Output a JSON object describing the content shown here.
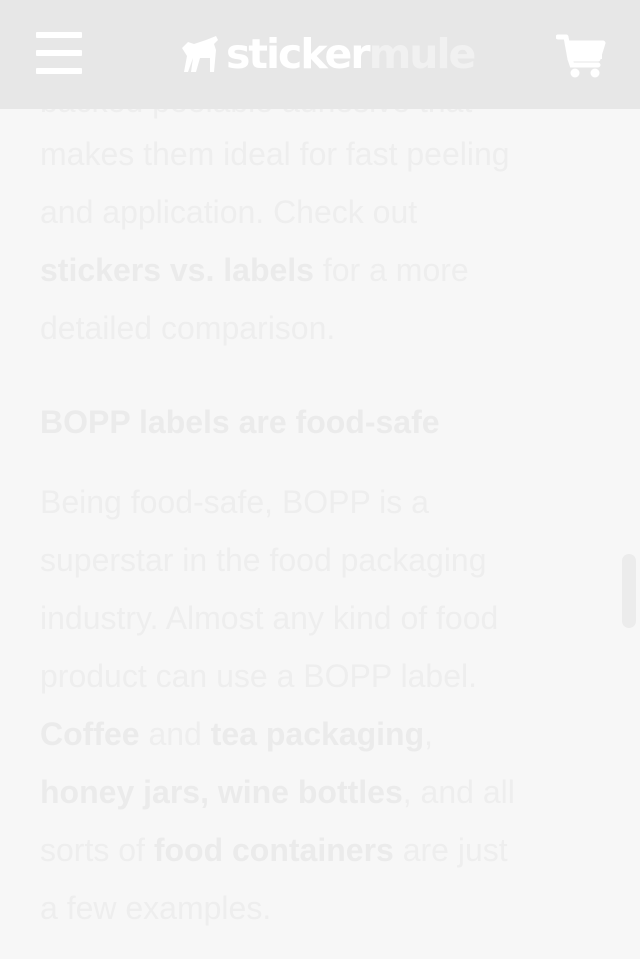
{
  "header": {
    "logo_part1": "sticker",
    "logo_part2": "mule",
    "menu_icon": "hamburger-menu-icon",
    "cart_icon": "shopping-cart-icon",
    "background": "#e7e7e7"
  },
  "article": {
    "intro": {
      "line_cut": "backed peelable adhesive that",
      "line1": "makes them ideal for fast peeling",
      "line2": "and application. Check out",
      "link_stickers_vs_labels": "stickers vs. labels",
      "line3_rest": " for a more",
      "line4": "detailed comparison."
    },
    "section_heading": "BOPP labels are food-safe",
    "body": {
      "line1": "Being food-safe, BOPP is a",
      "line2": "superstar in the food packaging",
      "line3": "industry. Almost any kind of food",
      "line4": "product can use a BOPP label.",
      "link_coffee": "Coffee",
      "and": " and ",
      "link_tea_packaging": "tea packaging",
      "comma": ",",
      "link_honey_jars": "honey jars",
      "comma_space": ", ",
      "link_wine_bottles": "wine bottles",
      "and_all": ", and all",
      "sorts_of": "sorts of ",
      "link_food_containers": "food containers",
      "are_just": " are just",
      "last_line": "a few examples."
    }
  },
  "colors": {
    "text": "#eeeeee",
    "page_bg": "#f7f7f7"
  }
}
